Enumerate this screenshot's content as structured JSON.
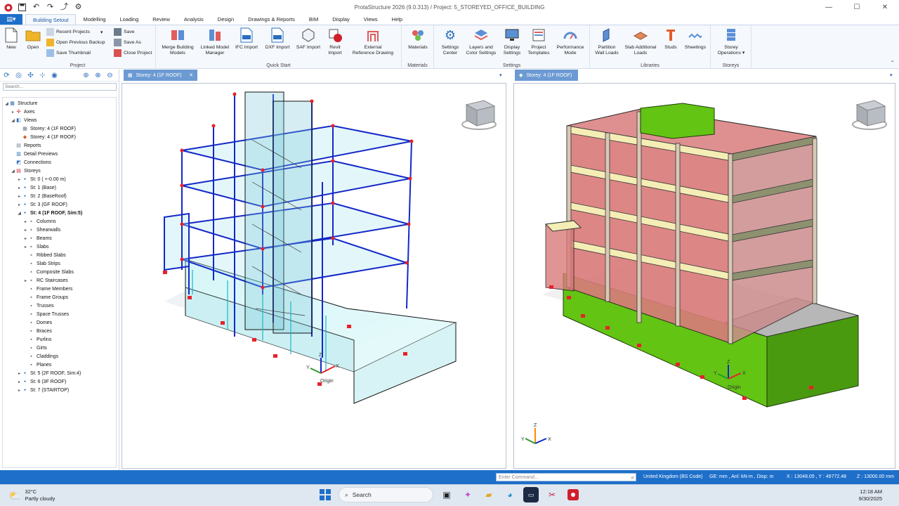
{
  "window": {
    "title": "ProtaStructure 2026 (9.0.313) / Project: 5_STOREYED_OFFICE_BUILDING",
    "controls": [
      "—",
      "☐",
      "✕"
    ]
  },
  "menu": {
    "file_label": "▤▾",
    "tabs": [
      "Building Setout",
      "Modelling",
      "Loading",
      "Review",
      "Analysis",
      "Design",
      "Drawings & Reports",
      "BIM",
      "Display",
      "Views",
      "Help"
    ],
    "active_tab": "Building Setout"
  },
  "ribbon": {
    "project": {
      "label": "Project",
      "new": "New",
      "open": "Open",
      "recent": "Recent Projects",
      "open_backup": "Open Previous Backup",
      "save_thumbnail": "Save Thumbnail",
      "save": "Save",
      "save_as": "Save As",
      "close": "Close Project"
    },
    "quick_start": {
      "label": "Quick Start",
      "merge": [
        "Merge Building",
        "Models"
      ],
      "linked": [
        "Linked Model",
        "Manager"
      ],
      "ifc": [
        "IFC Import",
        ""
      ],
      "dxf": [
        "DXF Import",
        ""
      ],
      "saf": [
        "SAF Import",
        ""
      ],
      "revit": [
        "Revit",
        "Import"
      ],
      "external": [
        "External",
        "Reference Drawing"
      ]
    },
    "materials": {
      "label": "Materials",
      "btn": "Materials"
    },
    "settings": {
      "label": "Settings",
      "center": [
        "Settings",
        "Center"
      ],
      "layers": [
        "Layers and",
        "Color Settings"
      ],
      "display": [
        "Display",
        "Settings"
      ],
      "templates": [
        "Project",
        "Templates"
      ],
      "performance": [
        "Performance",
        "Mode"
      ]
    },
    "libraries": {
      "label": "Libraries",
      "partition": [
        "Partition",
        "Wall Loads"
      ],
      "slab": [
        "Slab Additional",
        "Loads"
      ],
      "studs": [
        "Studs",
        ""
      ],
      "sheetings": [
        "Sheetings",
        ""
      ]
    },
    "storeys": {
      "label": "Storeys",
      "ops": [
        "Storey",
        "Operations ▾"
      ]
    }
  },
  "sidebar": {
    "search_placeholder": "Search...",
    "tree": [
      {
        "label": "Structure",
        "level": 0,
        "tw": "◢",
        "icon": "structure",
        "bold": false
      },
      {
        "label": "Axes",
        "level": 1,
        "tw": "▸",
        "icon": "axes",
        "bold": false
      },
      {
        "label": "Views",
        "level": 1,
        "tw": "◢",
        "icon": "views",
        "bold": false
      },
      {
        "label": "Storey: 4 (1F ROOF)",
        "level": 2,
        "tw": "",
        "icon": "grid",
        "bold": false
      },
      {
        "label": "Storey: 4 (1F ROOF)",
        "level": 2,
        "tw": "",
        "icon": "model3d",
        "bold": false
      },
      {
        "label": "Reports",
        "level": 1,
        "tw": "",
        "icon": "reports",
        "bold": false
      },
      {
        "label": "Detail Previews",
        "level": 1,
        "tw": "",
        "icon": "detail",
        "bold": false
      },
      {
        "label": "Connections",
        "level": 1,
        "tw": "",
        "icon": "connections",
        "bold": false
      },
      {
        "label": "Storeys",
        "level": 1,
        "tw": "◢",
        "icon": "storeys",
        "bold": false
      },
      {
        "label": "St: 0 ( +-0.00 m)",
        "level": 2,
        "tw": "▸",
        "icon": "dot",
        "bold": false
      },
      {
        "label": "St: 1 (Base)",
        "level": 2,
        "tw": "▸",
        "icon": "dot",
        "bold": false
      },
      {
        "label": "St: 2 (BaseRoof)",
        "level": 2,
        "tw": "▸",
        "icon": "dot",
        "bold": false
      },
      {
        "label": "St: 3 (GF ROOF)",
        "level": 2,
        "tw": "▸",
        "icon": "dot",
        "bold": false
      },
      {
        "label": "St: 4 (1F ROOF, Sim:5)",
        "level": 2,
        "tw": "◢",
        "icon": "dot",
        "bold": true
      },
      {
        "label": "Columns",
        "level": 3,
        "tw": "▸",
        "icon": "columns",
        "bold": false
      },
      {
        "label": "Shearwalls",
        "level": 3,
        "tw": "▸",
        "icon": "shearwalls",
        "bold": false
      },
      {
        "label": "Beams",
        "level": 3,
        "tw": "▸",
        "icon": "beams",
        "bold": false
      },
      {
        "label": "Slabs",
        "level": 3,
        "tw": "▸",
        "icon": "slabs",
        "bold": false
      },
      {
        "label": "Ribbed Slabs",
        "level": 3,
        "tw": "",
        "icon": "ribbed",
        "bold": false
      },
      {
        "label": "Slab Strips",
        "level": 3,
        "tw": "",
        "icon": "strips",
        "bold": false
      },
      {
        "label": "Composite Slabs",
        "level": 3,
        "tw": "",
        "icon": "composite",
        "bold": false
      },
      {
        "label": "RC Staircases",
        "level": 3,
        "tw": "▸",
        "icon": "stairs",
        "bold": false
      },
      {
        "label": "Frame Members",
        "level": 3,
        "tw": "",
        "icon": "frame",
        "bold": false
      },
      {
        "label": "Frame Groups",
        "level": 3,
        "tw": "",
        "icon": "framegroups",
        "bold": false
      },
      {
        "label": "Trusses",
        "level": 3,
        "tw": "",
        "icon": "trusses",
        "bold": false
      },
      {
        "label": "Space Trusses",
        "level": 3,
        "tw": "",
        "icon": "spacetrusses",
        "bold": false
      },
      {
        "label": "Domes",
        "level": 3,
        "tw": "",
        "icon": "domes",
        "bold": false
      },
      {
        "label": "Braces",
        "level": 3,
        "tw": "",
        "icon": "braces",
        "bold": false
      },
      {
        "label": "Purlins",
        "level": 3,
        "tw": "",
        "icon": "purlins",
        "bold": false
      },
      {
        "label": "Girts",
        "level": 3,
        "tw": "",
        "icon": "girts",
        "bold": false
      },
      {
        "label": "Claddings",
        "level": 3,
        "tw": "",
        "icon": "claddings",
        "bold": false
      },
      {
        "label": "Planes",
        "level": 3,
        "tw": "",
        "icon": "planes",
        "bold": false
      },
      {
        "label": "St: 5 (2F ROOF, Sim:4)",
        "level": 2,
        "tw": "▸",
        "icon": "dot",
        "bold": false
      },
      {
        "label": "St: 6 (3F ROOF)",
        "level": 2,
        "tw": "▸",
        "icon": "dot",
        "bold": false
      },
      {
        "label": "St: 7 (STAIRTOP)",
        "level": 2,
        "tw": "▸",
        "icon": "dot",
        "bold": false
      }
    ]
  },
  "viewports": {
    "left": {
      "tab": "Storey: 4 (1F ROOF)",
      "origin": "Origin",
      "axes": [
        "Z",
        "X",
        "Y"
      ]
    },
    "right": {
      "tab": "Storey: 4 (1F ROOF)",
      "origin": "Origin",
      "axes": [
        "Z",
        "X",
        "Y"
      ]
    }
  },
  "status": {
    "command_placeholder": "Enter Command...",
    "code": "United Kingdom (BS Code)",
    "units": "GE: mm , Anl: kN-m , Disp: m",
    "coords": "X : 13048.05 , Y : 49772.48",
    "z": "Z : 13000.00 mm"
  },
  "taskbar": {
    "temp": "32°C",
    "weather": "Partly cloudy",
    "search": "Search",
    "time": "12:18 AM",
    "date": "9/30/2025"
  },
  "colors": {
    "accent": "#1e6fc9",
    "frame_blue": "#1428c8",
    "node_red": "#e8202a",
    "slab_cyan": "#bfeff2",
    "wall_green": "#63c414",
    "slab_red": "#d97a7a",
    "beam_cream": "#f4edb5"
  }
}
